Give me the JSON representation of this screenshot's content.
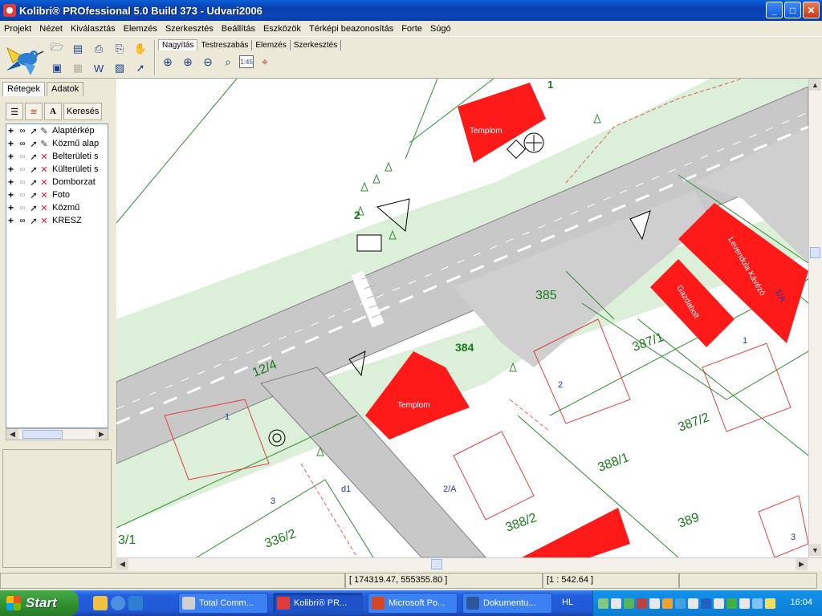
{
  "window": {
    "title": "Kolibri® PROfessional 5.0 Build 373 - Udvari2006",
    "buttons": {
      "minimize": "_",
      "maximize": "□",
      "close": "✕"
    }
  },
  "menu": [
    "Projekt",
    "Nézet",
    "Kiválasztás",
    "Elemzés",
    "Szerkesztés",
    "Beállítás",
    "Eszközök",
    "Térképi beazonosítás",
    "Forte",
    "Súgó"
  ],
  "toolbar": {
    "tabs": [
      "Nagyítás",
      "Testreszabás",
      "Elemzés",
      "Szerkesztés"
    ],
    "active_tab": "Nagyítás",
    "scale_button_label": "1:45"
  },
  "left_panel": {
    "tabs": [
      "Rétegek",
      "Adatok"
    ],
    "search_label": "Keresés",
    "layers": [
      {
        "name": "Alaptérkép",
        "visible": true,
        "editable": true
      },
      {
        "name": "Közmű alap",
        "visible": true,
        "editable": true
      },
      {
        "name": "Belterületi s",
        "visible": false,
        "editable": false
      },
      {
        "name": "Külterületi s",
        "visible": false,
        "editable": false
      },
      {
        "name": "Domborzat",
        "visible": false,
        "editable": false
      },
      {
        "name": "Foto",
        "visible": false,
        "editable": false
      },
      {
        "name": "Közmű",
        "visible": false,
        "editable": false
      },
      {
        "name": "KRESZ",
        "visible": true,
        "editable": false
      }
    ]
  },
  "map": {
    "parcels": [
      "1",
      "2",
      "385",
      "384",
      "12/4",
      "387/1",
      "387/2",
      "388/1",
      "388/2",
      "389",
      "336/2",
      "3/1",
      "2/A",
      "1/A",
      "1",
      "2",
      "3",
      "1",
      "3",
      "d1"
    ],
    "buildings": [
      "Templom",
      "Templom",
      "Levendula Kávézó",
      "Gazdabolt"
    ]
  },
  "status": {
    "coords": "[ 174319.47, 555355.80 ]",
    "scale": "[1 : 542.64 ]"
  },
  "taskbar": {
    "start": "Start",
    "tasks": [
      "Total Comm...",
      "Kolibri® PR...",
      "Microsoft Po...",
      "Dokumentu..."
    ],
    "active_task": "Kolibri® PR...",
    "lang": "HL",
    "clock": "16:04"
  }
}
